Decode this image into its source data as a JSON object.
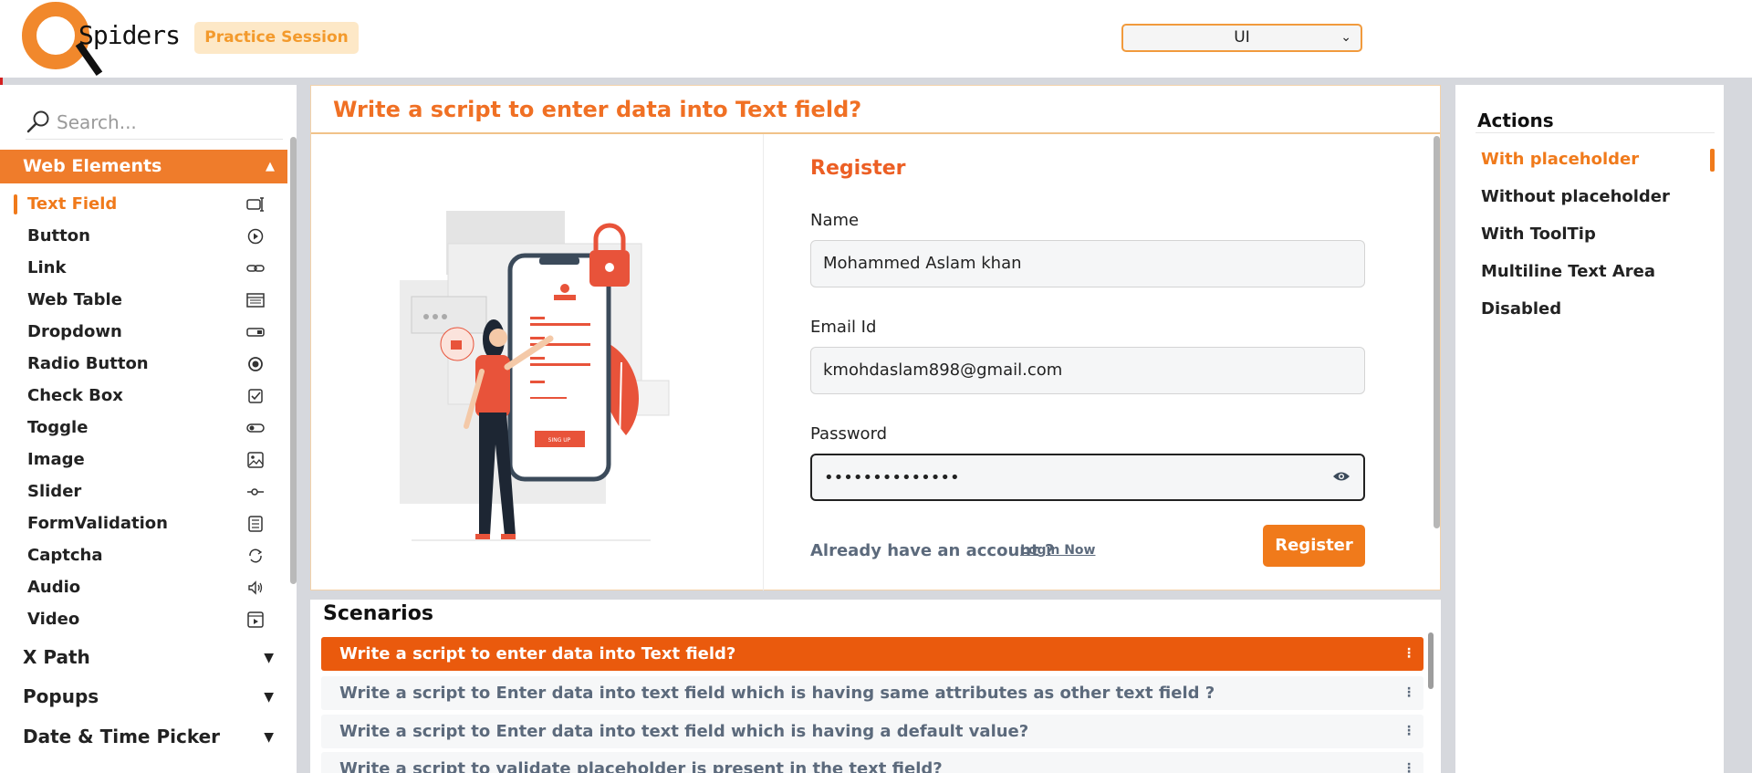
{
  "header": {
    "logo_text": "Spiders",
    "practice_label": "Practice Session",
    "category_select": {
      "value": "UI"
    }
  },
  "sidebar": {
    "search_placeholder": "Search...",
    "section_label": "Web Elements",
    "items": [
      {
        "label": "Text Field",
        "icon": "text-field-icon",
        "active": true
      },
      {
        "label": "Button",
        "icon": "play-circle-icon"
      },
      {
        "label": "Link",
        "icon": "link-icon"
      },
      {
        "label": "Web Table",
        "icon": "table-icon"
      },
      {
        "label": "Dropdown",
        "icon": "dropdown-icon"
      },
      {
        "label": "Radio Button",
        "icon": "radio-icon"
      },
      {
        "label": "Check Box",
        "icon": "checkbox-icon"
      },
      {
        "label": "Toggle",
        "icon": "toggle-icon"
      },
      {
        "label": "Image",
        "icon": "image-icon"
      },
      {
        "label": "Slider",
        "icon": "slider-icon"
      },
      {
        "label": "FormValidation",
        "icon": "form-icon"
      },
      {
        "label": "Captcha",
        "icon": "captcha-icon"
      },
      {
        "label": "Audio",
        "icon": "speaker-icon"
      },
      {
        "label": "Video",
        "icon": "video-icon"
      }
    ],
    "groups": [
      {
        "label": "X Path"
      },
      {
        "label": "Popups"
      },
      {
        "label": "Date & Time Picker"
      }
    ]
  },
  "main": {
    "title": "Write a script to enter data into Text field?",
    "form": {
      "heading": "Register",
      "name_label": "Name",
      "name_value": "Mohammed Aslam khan",
      "email_label": "Email Id",
      "email_value": "kmohdaslam898@gmail.com",
      "password_label": "Password",
      "password_value": "••••••••••••••",
      "already_text": "Already have an account ?",
      "login_link": "Login Now",
      "register_button": "Register"
    },
    "illustration_button_text": "SING UP"
  },
  "scenarios": {
    "title": "Scenarios",
    "items": [
      {
        "text": "Write a script to enter data into Text field?",
        "active": true
      },
      {
        "text": "Write a script to Enter data into text field which is having same attributes as other text field ?"
      },
      {
        "text": "Write a script to Enter data into text field which is having a default value?"
      },
      {
        "text": "Write a script to validate placeholder is present in the text field?"
      }
    ]
  },
  "actions": {
    "title": "Actions",
    "items": [
      {
        "label": "With placeholder",
        "active": true
      },
      {
        "label": "Without placeholder"
      },
      {
        "label": "With ToolTip"
      },
      {
        "label": "Multiline Text Area"
      },
      {
        "label": "Disabled"
      }
    ]
  },
  "colors": {
    "accent": "#f07a1b",
    "accent_dark": "#ea5a0d",
    "practice_bg": "#fde8c7",
    "muted_text": "#5c6a7c"
  }
}
